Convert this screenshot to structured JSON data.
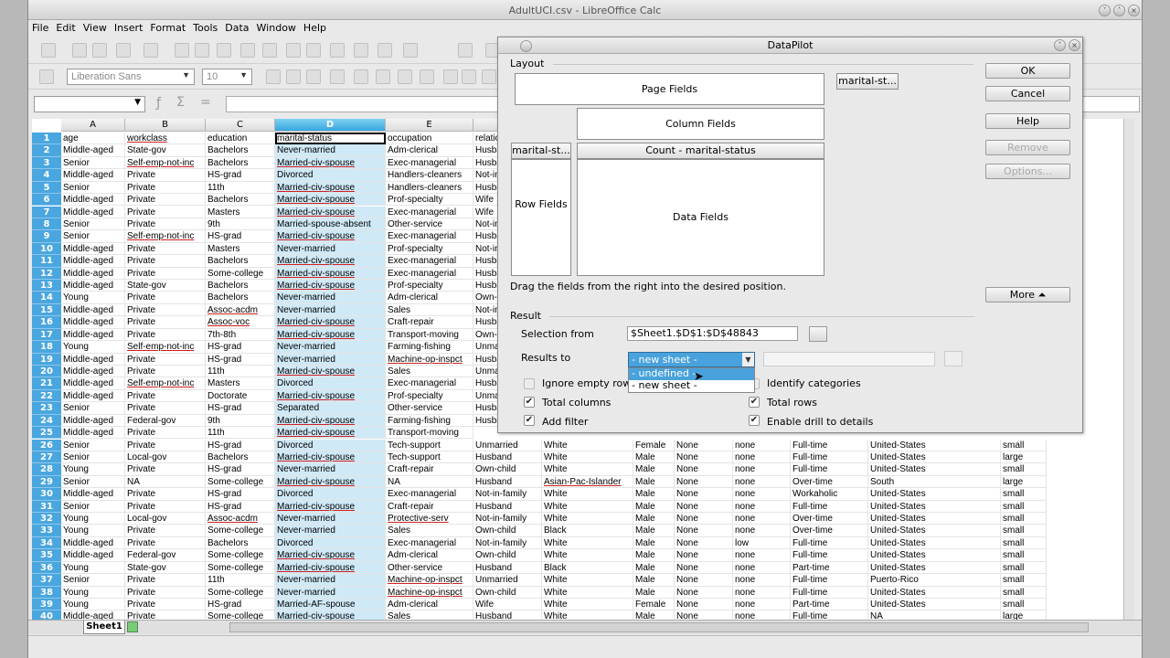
{
  "window": {
    "title": "AdultUCI.csv - LibreOffice Calc"
  },
  "menu": [
    "File",
    "Edit",
    "View",
    "Insert",
    "Format",
    "Tools",
    "Data",
    "Window",
    "Help"
  ],
  "toolbar": {
    "font_name": "Liberation Sans",
    "font_size": "10"
  },
  "columns": [
    "A",
    "B",
    "C",
    "D",
    "E"
  ],
  "selected_column": "D",
  "rows": [
    [
      "1",
      "age",
      "workclass",
      "education",
      "marital-status",
      "occupation"
    ],
    [
      "2",
      "Middle-aged",
      "State-gov",
      "Bachelors",
      "Never-married",
      "Adm-clerical"
    ],
    [
      "3",
      "Senior",
      "Self-emp-not-inc",
      "Bachelors",
      "Married-civ-spouse",
      "Exec-managerial"
    ],
    [
      "4",
      "Middle-aged",
      "Private",
      "HS-grad",
      "Divorced",
      "Handlers-cleaners"
    ],
    [
      "5",
      "Senior",
      "Private",
      "11th",
      "Married-civ-spouse",
      "Handlers-cleaners"
    ],
    [
      "6",
      "Middle-aged",
      "Private",
      "Bachelors",
      "Married-civ-spouse",
      "Prof-specialty"
    ],
    [
      "7",
      "Middle-aged",
      "Private",
      "Masters",
      "Married-civ-spouse",
      "Exec-managerial"
    ],
    [
      "8",
      "Senior",
      "Private",
      "9th",
      "Married-spouse-absent",
      "Other-service"
    ],
    [
      "9",
      "Senior",
      "Self-emp-not-inc",
      "HS-grad",
      "Married-civ-spouse",
      "Exec-managerial"
    ],
    [
      "10",
      "Middle-aged",
      "Private",
      "Masters",
      "Never-married",
      "Prof-specialty"
    ],
    [
      "11",
      "Middle-aged",
      "Private",
      "Bachelors",
      "Married-civ-spouse",
      "Exec-managerial"
    ],
    [
      "12",
      "Middle-aged",
      "Private",
      "Some-college",
      "Married-civ-spouse",
      "Exec-managerial"
    ],
    [
      "13",
      "Middle-aged",
      "State-gov",
      "Bachelors",
      "Married-civ-spouse",
      "Prof-specialty"
    ],
    [
      "14",
      "Young",
      "Private",
      "Bachelors",
      "Never-married",
      "Adm-clerical"
    ],
    [
      "15",
      "Middle-aged",
      "Private",
      "Assoc-acdm",
      "Never-married",
      "Sales"
    ],
    [
      "16",
      "Middle-aged",
      "Private",
      "Assoc-voc",
      "Married-civ-spouse",
      "Craft-repair"
    ],
    [
      "17",
      "Middle-aged",
      "Private",
      "7th-8th",
      "Married-civ-spouse",
      "Transport-moving"
    ],
    [
      "18",
      "Young",
      "Self-emp-not-inc",
      "HS-grad",
      "Never-married",
      "Farming-fishing"
    ],
    [
      "19",
      "Middle-aged",
      "Private",
      "HS-grad",
      "Never-married",
      "Machine-op-inspct"
    ],
    [
      "20",
      "Middle-aged",
      "Private",
      "11th",
      "Married-civ-spouse",
      "Sales"
    ],
    [
      "21",
      "Middle-aged",
      "Self-emp-not-inc",
      "Masters",
      "Divorced",
      "Exec-managerial"
    ],
    [
      "22",
      "Middle-aged",
      "Private",
      "Doctorate",
      "Married-civ-spouse",
      "Prof-specialty"
    ],
    [
      "23",
      "Senior",
      "Private",
      "HS-grad",
      "Separated",
      "Other-service"
    ],
    [
      "24",
      "Middle-aged",
      "Federal-gov",
      "9th",
      "Married-civ-spouse",
      "Farming-fishing"
    ],
    [
      "25",
      "Middle-aged",
      "Private",
      "11th",
      "Married-civ-spouse",
      "Transport-moving"
    ],
    [
      "26",
      "Senior",
      "Private",
      "HS-grad",
      "Divorced",
      "Tech-support"
    ],
    [
      "27",
      "Senior",
      "Local-gov",
      "Bachelors",
      "Married-civ-spouse",
      "Tech-support"
    ],
    [
      "28",
      "Young",
      "Private",
      "HS-grad",
      "Never-married",
      "Craft-repair"
    ],
    [
      "29",
      "Senior",
      "NA",
      "Some-college",
      "Married-civ-spouse",
      "NA"
    ],
    [
      "30",
      "Middle-aged",
      "Private",
      "HS-grad",
      "Divorced",
      "Exec-managerial"
    ],
    [
      "31",
      "Senior",
      "Private",
      "HS-grad",
      "Married-civ-spouse",
      "Craft-repair"
    ],
    [
      "32",
      "Young",
      "Local-gov",
      "Assoc-acdm",
      "Never-married",
      "Protective-serv"
    ],
    [
      "33",
      "Young",
      "Private",
      "Some-college",
      "Never-married",
      "Sales"
    ],
    [
      "34",
      "Middle-aged",
      "Private",
      "Bachelors",
      "Divorced",
      "Exec-managerial"
    ],
    [
      "35",
      "Middle-aged",
      "Federal-gov",
      "Some-college",
      "Married-civ-spouse",
      "Adm-clerical"
    ],
    [
      "36",
      "Young",
      "State-gov",
      "Some-college",
      "Married-civ-spouse",
      "Other-service"
    ],
    [
      "37",
      "Senior",
      "Private",
      "11th",
      "Never-married",
      "Machine-op-inspct"
    ],
    [
      "38",
      "Young",
      "Private",
      "Some-college",
      "Never-married",
      "Machine-op-inspct"
    ],
    [
      "39",
      "Young",
      "Private",
      "HS-grad",
      "Married-AF-spouse",
      "Adm-clerical"
    ],
    [
      "40",
      "Middle-aged",
      "Private",
      "Some-college",
      "Married-civ-spouse",
      "Sales"
    ]
  ],
  "col_f_partial": [
    "relatio",
    "Husba",
    "Husba",
    "Not-in",
    "Husba",
    "Wife",
    "Wife",
    "Not-in",
    "Husba",
    "Not-in",
    "Husba",
    "Husba",
    "Husba",
    "Own-",
    "Not-in",
    "Husba",
    "Own-c",
    "Unma",
    "Husba",
    "Unma",
    "Husba",
    "Unma",
    "Husba",
    "Husba"
  ],
  "lower_rows": [
    [
      "Unmarried",
      "White",
      "Female",
      "None",
      "none",
      "Full-time",
      "United-States",
      "small"
    ],
    [
      "Husband",
      "White",
      "Male",
      "None",
      "none",
      "Full-time",
      "United-States",
      "large"
    ],
    [
      "Own-child",
      "White",
      "Male",
      "None",
      "none",
      "Full-time",
      "United-States",
      "small"
    ],
    [
      "Husband",
      "Asian-Pac-Islander",
      "Male",
      "None",
      "none",
      "Over-time",
      "South",
      "large"
    ],
    [
      "Not-in-family",
      "White",
      "Male",
      "None",
      "none",
      "Workaholic",
      "United-States",
      "small"
    ],
    [
      "Husband",
      "White",
      "Male",
      "None",
      "none",
      "Full-time",
      "United-States",
      "small"
    ],
    [
      "Not-in-family",
      "White",
      "Male",
      "None",
      "none",
      "Over-time",
      "United-States",
      "small"
    ],
    [
      "Own-child",
      "Black",
      "Male",
      "None",
      "none",
      "Over-time",
      "United-States",
      "small"
    ],
    [
      "Not-in-family",
      "White",
      "Male",
      "None",
      "low",
      "Full-time",
      "United-States",
      "small"
    ],
    [
      "Own-child",
      "White",
      "Male",
      "None",
      "none",
      "Full-time",
      "United-States",
      "small"
    ],
    [
      "Husband",
      "Black",
      "Male",
      "None",
      "none",
      "Part-time",
      "United-States",
      "small"
    ],
    [
      "Unmarried",
      "White",
      "Male",
      "None",
      "none",
      "Full-time",
      "Puerto-Rico",
      "small"
    ],
    [
      "Own-child",
      "White",
      "Male",
      "None",
      "none",
      "Full-time",
      "United-States",
      "small"
    ],
    [
      "Wife",
      "White",
      "Female",
      "None",
      "none",
      "Part-time",
      "United-States",
      "small"
    ],
    [
      "Husband",
      "White",
      "Male",
      "None",
      "none",
      "Full-time",
      "NA",
      "large"
    ]
  ],
  "sheet_tab": "Sheet1",
  "dialog": {
    "title": "DataPilot",
    "layout_label": "Layout",
    "page_fields": "Page Fields",
    "column_fields": "Column Fields",
    "row_fields": "Row Fields",
    "data_fields": "Data Fields",
    "row_field_button": "marital-st...",
    "data_field_button": "Count - marital-status",
    "available_field": "marital-st...",
    "hint": "Drag the fields from the right into the desired position.",
    "ok": "OK",
    "cancel": "Cancel",
    "help": "Help",
    "remove": "Remove",
    "options": "Options...",
    "more": "More",
    "result_label": "Result",
    "selection_from_label": "Selection from",
    "selection_from_value": "$Sheet1.$D$1:$D$48843",
    "results_to_label": "Results to",
    "results_to_value": "- new sheet -",
    "dropdown_options": [
      "- undefined -",
      "- new sheet -"
    ],
    "ignore_empty_rows": "Ignore empty rows",
    "identify_categories": "Identify categories",
    "total_columns": "Total columns",
    "total_rows": "Total rows",
    "add_filter": "Add filter",
    "enable_drill": "Enable drill to details"
  }
}
